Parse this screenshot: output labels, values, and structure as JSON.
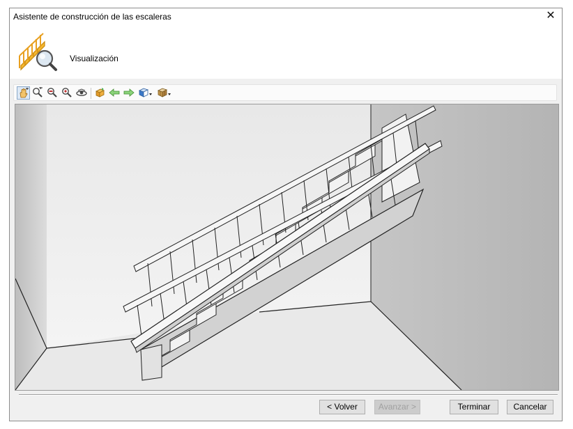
{
  "window": {
    "title": "Asistente de construcción de las escaleras"
  },
  "header": {
    "section_label": "Visualización",
    "icon": "stair-wizard-magnifier-icon"
  },
  "toolbar": {
    "tools": [
      {
        "icon": "pan-hand-icon",
        "active": true
      },
      {
        "icon": "zoom-window-icon"
      },
      {
        "icon": "zoom-in-icon"
      },
      {
        "icon": "zoom-out-icon"
      },
      {
        "icon": "orbit-eye-icon"
      },
      {
        "icon": "view-cube-icon"
      },
      {
        "icon": "rotate-left-arrow-icon"
      },
      {
        "icon": "rotate-right-arrow-icon"
      },
      {
        "icon": "render-mode-dropdown-icon"
      },
      {
        "icon": "view-box-dropdown-icon"
      }
    ]
  },
  "buttons": {
    "back": "< Volver",
    "next": "Avanzar >",
    "finish": "Terminar",
    "cancel": "Cancelar"
  },
  "colors": {
    "viewport_bg": "#dcdcdc",
    "icon_orange": "#f0a020",
    "icon_green": "#4caf50",
    "icon_blue": "#3a78c8"
  }
}
